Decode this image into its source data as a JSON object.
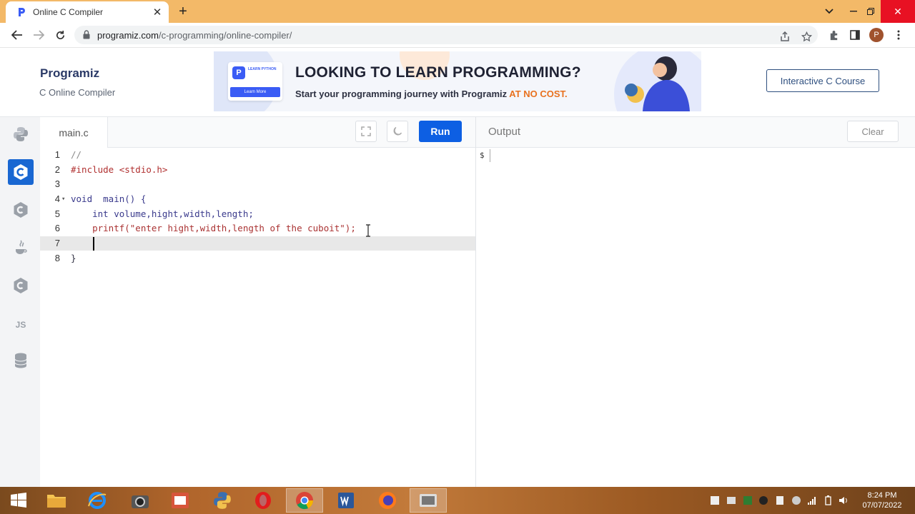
{
  "browser": {
    "tab_title": "Online C Compiler",
    "url_host": "programiz.com",
    "url_path": "/c-programming/online-compiler/",
    "profile_initial": "P"
  },
  "site": {
    "logo_text": "Programiz",
    "subtitle": "C Online Compiler",
    "banner": {
      "card_label": "LEARN PYTHON",
      "card_button": "Learn More",
      "headline": "LOOKING TO LEARN PROGRAMMING?",
      "tagline": "Start your programming journey with Programiz",
      "tagline_highlight": "AT NO COST."
    },
    "course_button": "Interactive C Course"
  },
  "languages": [
    {
      "name": "python-icon"
    },
    {
      "name": "c-icon",
      "active": true
    },
    {
      "name": "cpp-icon"
    },
    {
      "name": "java-icon"
    },
    {
      "name": "csharp-icon"
    },
    {
      "name": "js-icon",
      "label": "JS"
    },
    {
      "name": "sql-icon"
    }
  ],
  "editor": {
    "file_tab": "main.c",
    "run_label": "Run",
    "lines": [
      {
        "n": "1",
        "text": "//"
      },
      {
        "n": "2",
        "text": "#include <stdio.h>"
      },
      {
        "n": "3",
        "text": ""
      },
      {
        "n": "4",
        "text": "void  main() {"
      },
      {
        "n": "5",
        "text": "    int volume,hight,width,length;"
      },
      {
        "n": "6",
        "text": "    printf(\"enter hight,width,length of the cuboit\");"
      },
      {
        "n": "7",
        "text": ""
      },
      {
        "n": "8",
        "text": "}"
      }
    ],
    "active_line": 7
  },
  "output": {
    "title": "Output",
    "clear_label": "Clear",
    "prompt": "$"
  },
  "taskbar": {
    "time": "8:24 PM",
    "date": "07/07/2022"
  },
  "colors": {
    "run_blue": "#0d5fe3",
    "active_lang": "#1967d2",
    "tab_strip": "#f3b968"
  }
}
